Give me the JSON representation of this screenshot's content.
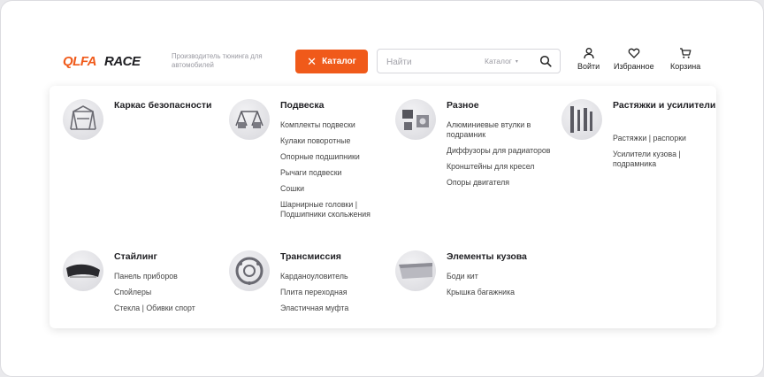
{
  "header": {
    "logo_text": "QLFARACE",
    "tagline": "Производитель тюнинга для автомобилей",
    "catalog_label": "Каталог",
    "search": {
      "placeholder": "Найти",
      "scope": "Каталог"
    },
    "actions": {
      "login": "Войти",
      "favorites": "Избранное",
      "cart": "Корзина"
    }
  },
  "colors": {
    "accent": "#f05a1a",
    "text": "#222222",
    "muted": "#9a9aa2"
  },
  "menu": {
    "categories": [
      {
        "title": "Каркас безопасности",
        "icon": "roll-cage",
        "items": []
      },
      {
        "title": "Подвеска",
        "icon": "suspension",
        "items": [
          "Комплекты подвески",
          "Кулаки поворотные",
          "Опорные подшипники",
          "Рычаги подвески",
          "Сошки",
          "Шарнирные головки | Подшипники скольжения"
        ]
      },
      {
        "title": "Разное",
        "icon": "misc-parts",
        "items": [
          "Алюминиевые втулки в подрамник",
          "Диффузоры для радиаторов",
          "Кронштейны для кресел",
          "Опоры двигателя"
        ]
      },
      {
        "title": "Растяжки и усилители",
        "icon": "strut-bars",
        "items": [
          "Растяжки | распорки",
          "Усилители кузова | подрамника"
        ]
      },
      {
        "title": "Стайлинг",
        "icon": "styling",
        "items": [
          "Панель приборов",
          "Спойлеры",
          "Стекла | Обивки спорт"
        ]
      },
      {
        "title": "Трансмиссия",
        "icon": "transmission",
        "items": [
          "Карданоуловитель",
          "Плита переходная",
          "Эластичная муфта"
        ]
      },
      {
        "title": "Элементы кузова",
        "icon": "body-parts",
        "items": [
          "Боди кит",
          "Крышка багажника"
        ]
      }
    ]
  }
}
